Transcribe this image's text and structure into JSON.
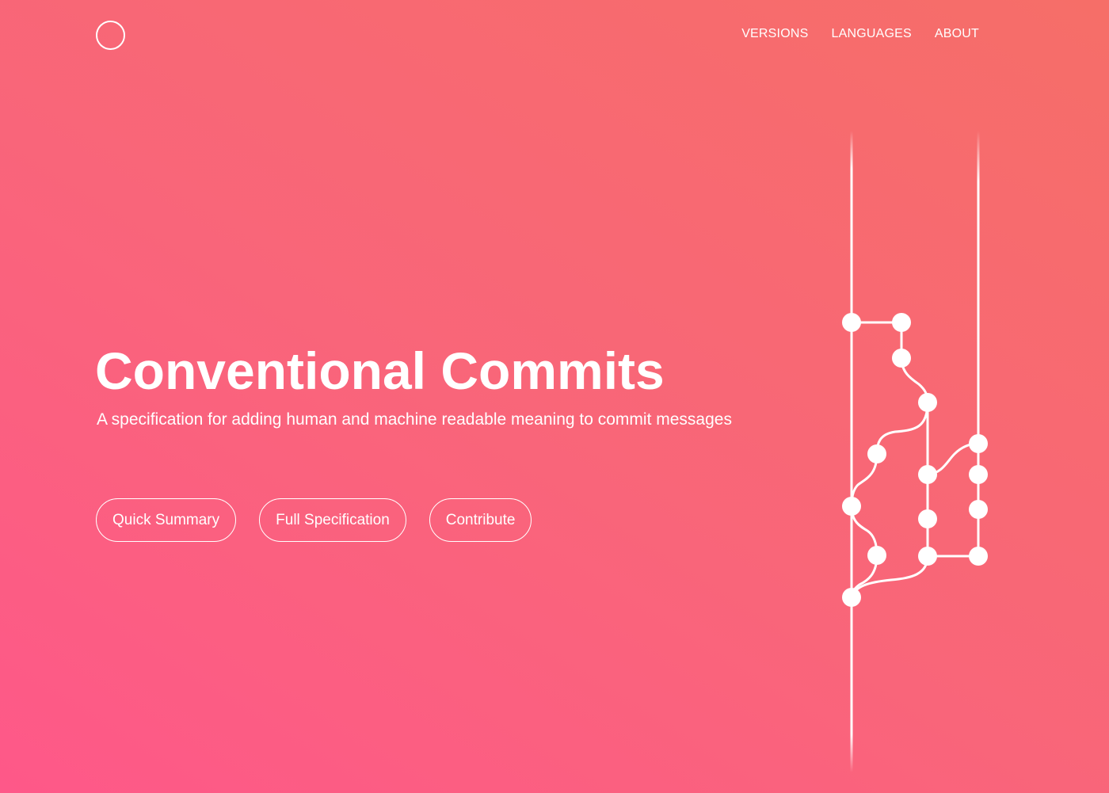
{
  "header": {
    "logo_icon": "circle-outline-icon",
    "nav": [
      {
        "label": "VERSIONS"
      },
      {
        "label": "LANGUAGES"
      },
      {
        "label": "ABOUT"
      }
    ]
  },
  "hero": {
    "title": "Conventional Commits",
    "subtitle": "A specification for adding human and machine readable meaning to commit messages",
    "buttons": [
      {
        "label": "Quick Summary"
      },
      {
        "label": "Full Specification"
      },
      {
        "label": "Contribute"
      }
    ],
    "illustration_icon": "git-branch-graph-icon"
  },
  "colors": {
    "gradient_start": "#fe5889",
    "gradient_end": "#f66e68",
    "foreground": "#ffffff"
  }
}
